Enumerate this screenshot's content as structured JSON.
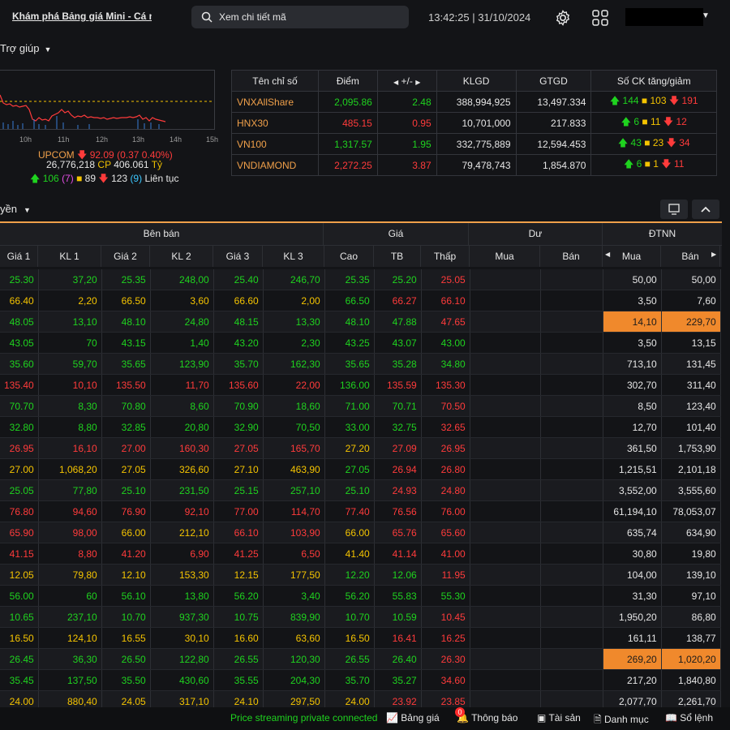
{
  "header": {
    "title": "Khám phá Bảng giá Mini - Cá nhân",
    "search_placeholder": "Xem chi tiết mã",
    "time": "13:42:25",
    "date": "31/10/2024"
  },
  "menu": {
    "help_label": "Trợ giúp"
  },
  "mini_chart": {
    "x_ticks": [
      "10h",
      "11h",
      "12h",
      "13h",
      "14h",
      "15h"
    ],
    "index_name": "UPCOM",
    "index_value": "92.09",
    "index_change": "(0.37 0.40%)",
    "volume": "26,776,218",
    "cp_label": "CP",
    "value": "406.061",
    "unit": "Tỷ",
    "up": "106",
    "up_ceiling": "(7)",
    "unchanged": "89",
    "down": "123",
    "down_floor": "(9)",
    "continuous_label": "Liên tục",
    "colors": {
      "up": "#1fd31f",
      "down": "#ff3b3b",
      "ref": "#f5c400"
    }
  },
  "index_table": {
    "headers": [
      "Tên chỉ số",
      "Điểm",
      "+/-",
      "KLGD",
      "GTGD",
      "Số CK tăng/giảm"
    ],
    "rows": [
      {
        "name": "VNXAllShare",
        "point": "2,095.86",
        "change": "2.48",
        "vol": "388,994,925",
        "val": "13,497.334",
        "up": "144",
        "ref": "103",
        "down": "191",
        "dir": "up"
      },
      {
        "name": "HNX30",
        "point": "485.15",
        "change": "0.95",
        "vol": "10,701,000",
        "val": "217.833",
        "up": "6",
        "ref": "11",
        "down": "12",
        "dir": "down"
      },
      {
        "name": "VN100",
        "point": "1,317.57",
        "change": "1.95",
        "vol": "332,775,889",
        "val": "12,594.453",
        "up": "43",
        "ref": "23",
        "down": "34",
        "dir": "up"
      },
      {
        "name": "VNDIAMOND",
        "point": "2,272.25",
        "change": "3.87",
        "vol": "79,478,743",
        "val": "1,854.870",
        "up": "6",
        "ref": "1",
        "down": "11",
        "dir": "down"
      }
    ]
  },
  "filter": {
    "label": "yền"
  },
  "board": {
    "group_headers": {
      "sell": "Bên bán",
      "price": "Giá",
      "residual": "Dư",
      "foreign": "ĐTNN"
    },
    "sub_headers": [
      "Giá 1",
      "KL 1",
      "Giá 2",
      "KL 2",
      "Giá 3",
      "KL 3",
      "Cao",
      "TB",
      "Thấp",
      "Mua",
      "Bán",
      "Mua",
      "Bán"
    ],
    "rows": [
      {
        "c": "g",
        "p1": "25.30",
        "k1": "37,20",
        "p2": "25.35",
        "k2": "248,00",
        "p3": "25.40",
        "k3": "246,70",
        "hi": "25.35",
        "hic": "g",
        "av": "25.20",
        "avc": "g",
        "lo": "25.05",
        "loc": "r",
        "fb": "50,00",
        "fs": "50,00",
        "hl": false
      },
      {
        "c": "y",
        "p1": "66.40",
        "k1": "2,20",
        "p2": "66.50",
        "k2": "3,60",
        "p3": "66.60",
        "k3": "2,00",
        "hi": "66.50",
        "hic": "g",
        "av": "66.27",
        "avc": "r",
        "lo": "66.10",
        "loc": "r",
        "fb": "3,50",
        "fs": "7,60",
        "hl": false
      },
      {
        "c": "g",
        "p1": "48.05",
        "k1": "13,10",
        "p2": "48.10",
        "k2": "24,80",
        "p3": "48.15",
        "k3": "13,30",
        "hi": "48.10",
        "hic": "g",
        "av": "47.88",
        "avc": "g",
        "lo": "47.65",
        "loc": "r",
        "fb": "14,10",
        "fs": "229,70",
        "hl": true
      },
      {
        "c": "g",
        "p1": "43.05",
        "k1": "70",
        "p2": "43.15",
        "k2": "1,40",
        "p3": "43.20",
        "k3": "2,30",
        "hi": "43.25",
        "hic": "g",
        "av": "43.07",
        "avc": "g",
        "lo": "43.00",
        "loc": "g",
        "fb": "3,50",
        "fs": "13,15",
        "hl": false
      },
      {
        "c": "g",
        "p1": "35.60",
        "k1": "59,70",
        "p2": "35.65",
        "k2": "123,90",
        "p3": "35.70",
        "k3": "162,30",
        "hi": "35.65",
        "hic": "g",
        "av": "35.28",
        "avc": "g",
        "lo": "34.80",
        "loc": "g",
        "fb": "713,10",
        "fs": "131,45",
        "hl": false
      },
      {
        "c": "r",
        "p1": "135.40",
        "k1": "10,10",
        "p2": "135.50",
        "k2": "11,70",
        "p3": "135.60",
        "k3": "22,00",
        "hi": "136.00",
        "hic": "g",
        "av": "135.59",
        "avc": "r",
        "lo": "135.30",
        "loc": "r",
        "fb": "302,70",
        "fs": "311,40",
        "hl": false
      },
      {
        "c": "g",
        "p1": "70.70",
        "k1": "8,30",
        "p2": "70.80",
        "k2": "8,60",
        "p3": "70.90",
        "k3": "18,60",
        "hi": "71.00",
        "hic": "g",
        "av": "70.71",
        "avc": "g",
        "lo": "70.50",
        "loc": "r",
        "fb": "8,50",
        "fs": "123,40",
        "hl": false
      },
      {
        "c": "g",
        "p1": "32.80",
        "k1": "8,80",
        "p2": "32.85",
        "k2": "20,80",
        "p3": "32.90",
        "k3": "70,50",
        "hi": "33.00",
        "hic": "g",
        "av": "32.75",
        "avc": "g",
        "lo": "32.65",
        "loc": "r",
        "fb": "12,70",
        "fs": "101,40",
        "hl": false
      },
      {
        "c": "r",
        "p1": "26.95",
        "k1": "16,10",
        "p2": "27.00",
        "k2": "160,30",
        "p3": "27.05",
        "k3": "165,70",
        "hi": "27.20",
        "hic": "y",
        "av": "27.09",
        "avc": "r",
        "lo": "26.95",
        "loc": "r",
        "fb": "361,50",
        "fs": "1,753,90",
        "hl": false
      },
      {
        "c": "y",
        "p1": "27.00",
        "k1": "1,068,20",
        "p2": "27.05",
        "k2": "326,60",
        "p3": "27.10",
        "k3": "463,90",
        "hi": "27.05",
        "hic": "g",
        "av": "26.94",
        "avc": "r",
        "lo": "26.80",
        "loc": "r",
        "fb": "1,215,51",
        "fs": "2,101,18",
        "hl": false
      },
      {
        "c": "g",
        "p1": "25.05",
        "k1": "77,80",
        "p2": "25.10",
        "k2": "231,50",
        "p3": "25.15",
        "k3": "257,10",
        "hi": "25.10",
        "hic": "g",
        "av": "24.93",
        "avc": "r",
        "lo": "24.80",
        "loc": "r",
        "fb": "3,552,00",
        "fs": "3,555,60",
        "hl": false
      },
      {
        "c": "r",
        "p1": "76.80",
        "k1": "94,60",
        "p2": "76.90",
        "k2": "92,10",
        "p3": "77.00",
        "k3": "114,70",
        "hi": "77.40",
        "hic": "r",
        "av": "76.56",
        "avc": "r",
        "lo": "76.00",
        "loc": "r",
        "fb": "61,194,10",
        "fs": "78,053,07",
        "hl": false
      },
      {
        "c": "r",
        "p1": "65.90",
        "k1": "98,00",
        "p2": "66.00",
        "k2": "212,10",
        "p3": "66.10",
        "k3": "103,90",
        "hi": "66.00",
        "hic": "y",
        "av": "65.76",
        "avc": "r",
        "lo": "65.60",
        "loc": "r",
        "fb": "635,74",
        "fs": "634,90",
        "hl": false,
        "p2c": "y"
      },
      {
        "c": "r",
        "p1": "41.15",
        "k1": "8,80",
        "p2": "41.20",
        "k2": "6,90",
        "p3": "41.25",
        "k3": "6,50",
        "hi": "41.40",
        "hic": "y",
        "av": "41.14",
        "avc": "r",
        "lo": "41.00",
        "loc": "r",
        "fb": "30,80",
        "fs": "19,80",
        "hl": false
      },
      {
        "c": "y",
        "p1": "12.05",
        "k1": "79,80",
        "p2": "12.10",
        "k2": "153,30",
        "p3": "12.15",
        "k3": "177,50",
        "hi": "12.20",
        "hic": "g",
        "av": "12.06",
        "avc": "g",
        "lo": "11.95",
        "loc": "r",
        "fb": "104,00",
        "fs": "139,10",
        "hl": false
      },
      {
        "c": "g",
        "p1": "56.00",
        "k1": "60",
        "p2": "56.10",
        "k2": "13,80",
        "p3": "56.20",
        "k3": "3,40",
        "hi": "56.20",
        "hic": "g",
        "av": "55.83",
        "avc": "g",
        "lo": "55.30",
        "loc": "g",
        "fb": "31,30",
        "fs": "97,10",
        "hl": false
      },
      {
        "c": "g",
        "p1": "10.65",
        "k1": "237,10",
        "p2": "10.70",
        "k2": "937,30",
        "p3": "10.75",
        "k3": "839,90",
        "hi": "10.70",
        "hic": "g",
        "av": "10.59",
        "avc": "g",
        "lo": "10.45",
        "loc": "r",
        "fb": "1,950,20",
        "fs": "86,80",
        "hl": false
      },
      {
        "c": "y",
        "p1": "16.50",
        "k1": "124,10",
        "p2": "16.55",
        "k2": "30,10",
        "p3": "16.60",
        "k3": "63,60",
        "hi": "16.50",
        "hic": "y",
        "av": "16.41",
        "avc": "r",
        "lo": "16.25",
        "loc": "r",
        "fb": "161,11",
        "fs": "138,77",
        "hl": false
      },
      {
        "c": "g",
        "p1": "26.45",
        "k1": "36,30",
        "p2": "26.50",
        "k2": "122,80",
        "p3": "26.55",
        "k3": "120,30",
        "hi": "26.55",
        "hic": "g",
        "av": "26.40",
        "avc": "g",
        "lo": "26.30",
        "loc": "r",
        "fb": "269,20",
        "fs": "1,020,20",
        "hl": true
      },
      {
        "c": "g",
        "p1": "35.45",
        "k1": "137,50",
        "p2": "35.50",
        "k2": "430,60",
        "p3": "35.55",
        "k3": "204,30",
        "hi": "35.70",
        "hic": "g",
        "av": "35.27",
        "avc": "g",
        "lo": "34.60",
        "loc": "r",
        "fb": "217,20",
        "fs": "1,840,80",
        "hl": false
      },
      {
        "c": "y",
        "p1": "24.00",
        "k1": "880,40",
        "p2": "24.05",
        "k2": "317,10",
        "p3": "24.10",
        "k3": "297,50",
        "hi": "24.00",
        "hic": "y",
        "av": "23.92",
        "avc": "r",
        "lo": "23.85",
        "loc": "r",
        "fb": "2,077,70",
        "fs": "2,261,70",
        "hl": false
      }
    ]
  },
  "footer": {
    "stream_status": "Price streaming private connected",
    "board_label": "Bảng giá",
    "notify_label": "Thông báo",
    "notify_badge": "0",
    "assets_label": "Tài sản",
    "list_label": "Danh mục",
    "order_label": "Sổ lệnh"
  }
}
